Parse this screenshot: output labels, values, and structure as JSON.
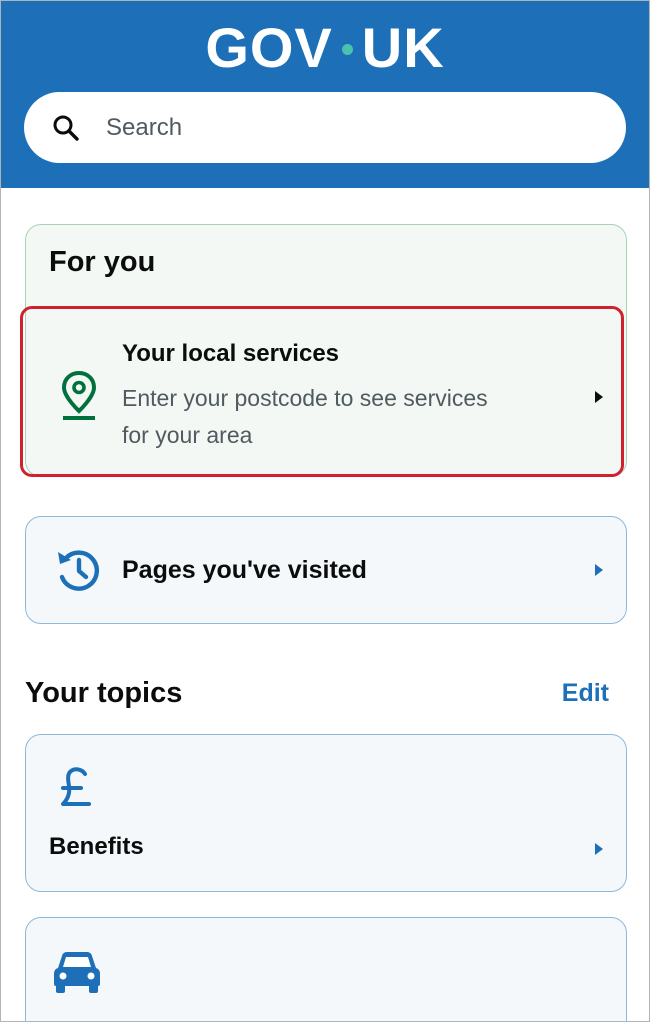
{
  "header": {
    "logo_left": "GOV",
    "logo_right": "UK",
    "search_placeholder": "Search"
  },
  "for_you": {
    "heading": "For you",
    "local_services": {
      "title": "Your local services",
      "subtitle_line1": "Enter your postcode to see services",
      "subtitle_line2": "for your area"
    }
  },
  "visited": {
    "title": "Pages you've visited"
  },
  "topics": {
    "heading": "Your topics",
    "edit_label": "Edit",
    "items": [
      {
        "label": "Benefits",
        "icon": "pound-icon"
      },
      {
        "label": "",
        "icon": "car-icon"
      }
    ]
  },
  "colors": {
    "brand_blue": "#1d70b8",
    "green_icon": "#00703c",
    "highlight_red": "#d0212f"
  }
}
